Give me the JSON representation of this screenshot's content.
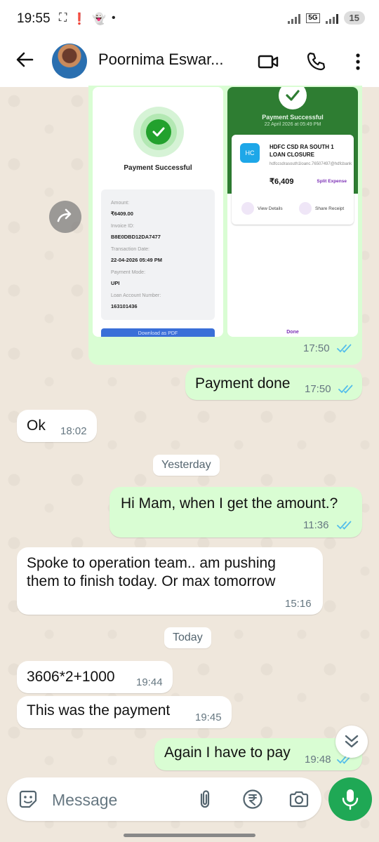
{
  "status_bar": {
    "time": "19:55",
    "network": "5G",
    "battery": "15"
  },
  "header": {
    "contact_name": "Poornima Eswar...",
    "icons": [
      "back-arrow-icon",
      "video-call-icon",
      "phone-icon",
      "more-vertical-icon"
    ]
  },
  "image_message": {
    "left_screenshot": {
      "title": "Payment Successful",
      "fields": [
        {
          "label": "Amount:",
          "value": "₹6409.00"
        },
        {
          "label": "Invoice ID:",
          "value": "B8E0DBD12DA7477"
        },
        {
          "label": "Transaction Date:",
          "value": "22-04-2026 05:49 PM"
        },
        {
          "label": "Payment Mode:",
          "value": "UPI"
        },
        {
          "label": "Loan Account Number:",
          "value": "163101436"
        }
      ],
      "download_label": "Download as PDF"
    },
    "right_screenshot": {
      "title": "Payment Successful",
      "date": "22 April 2026 at 05:49 PM",
      "payee_initials": "HC",
      "payee_name": "HDFC CSD RA SOUTH 1 LOAN CLOSURE",
      "payee_upi": "hdfccsdrasouth1loanc.76507497@hdfcbank",
      "amount": "₹6,409",
      "split_label": "Split Expense",
      "view_details": "View Details",
      "share_receipt": "Share Receipt",
      "done": "Done"
    },
    "time": "17:50"
  },
  "messages": [
    {
      "id": "m1",
      "direction": "out",
      "text": "Payment done",
      "time": "17:50"
    },
    {
      "id": "m2",
      "direction": "in",
      "text": "Ok",
      "time": "18:02"
    },
    {
      "id": "m3",
      "direction": "out",
      "text": "Hi Mam, when I get the amount.?",
      "time": "11:36"
    },
    {
      "id": "m4",
      "direction": "in",
      "text": "Spoke to operation team.. am pushing them to finish today. Or max tomorrow",
      "time": "15:16"
    },
    {
      "id": "m5",
      "direction": "in",
      "text": "3606*2+1000",
      "time": "19:44"
    },
    {
      "id": "m6",
      "direction": "in",
      "text": "This was the payment",
      "time": "19:45"
    },
    {
      "id": "m7",
      "direction": "out",
      "text": "Again I have to pay",
      "time": "19:48"
    }
  ],
  "date_dividers": {
    "yesterday": "Yesterday",
    "today": "Today"
  },
  "composer": {
    "placeholder": "Message",
    "icons": [
      "sticker-icon",
      "attach-icon",
      "rupee-payment-icon",
      "camera-icon",
      "mic-icon"
    ]
  },
  "colors": {
    "outgoing_bubble": "#d9fdd3",
    "incoming_bubble": "#ffffff",
    "read_ticks": "#53bdeb",
    "accent_green": "#1fa855"
  }
}
